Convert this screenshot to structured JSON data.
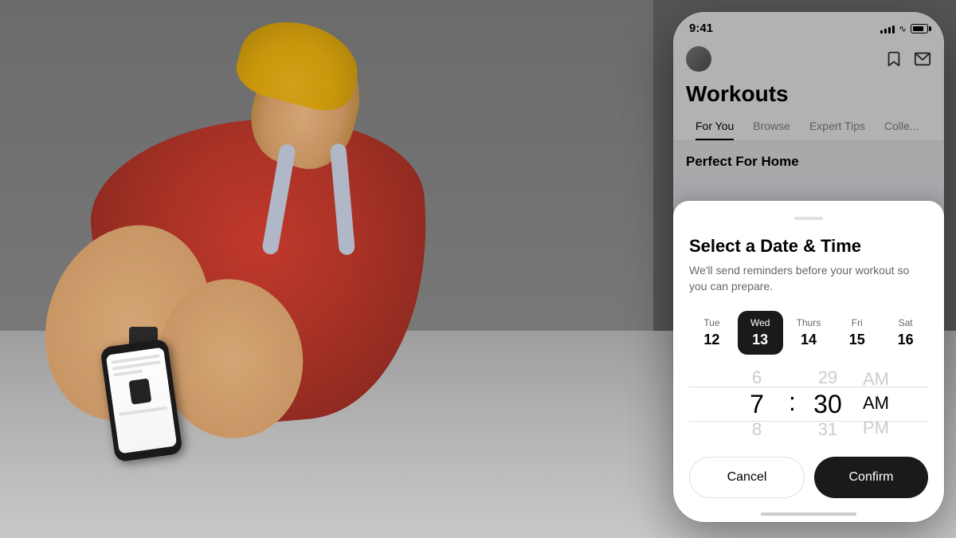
{
  "background": {
    "colors": {
      "wall": "#6b6b6b",
      "floor": "#b5b5b5"
    }
  },
  "phone_mockup": {
    "status_bar": {
      "time": "9:41",
      "signal": "signal",
      "wifi": "wifi",
      "battery": "battery"
    },
    "header": {
      "bookmark_icon": "bookmark",
      "mail_icon": "mail"
    },
    "title": "Workouts",
    "nav_tabs": [
      {
        "label": "For You",
        "active": true
      },
      {
        "label": "Browse",
        "active": false
      },
      {
        "label": "Expert Tips",
        "active": false
      },
      {
        "label": "Colle...",
        "active": false
      }
    ],
    "section_title": "Perfect For Home"
  },
  "modal": {
    "title": "Select a Date & Time",
    "subtitle": "We'll send reminders before your workout so you can prepare.",
    "days": [
      {
        "name": "Tue",
        "num": "12",
        "selected": false
      },
      {
        "name": "Wed",
        "num": "13",
        "selected": true
      },
      {
        "name": "Thurs",
        "num": "14",
        "selected": false
      },
      {
        "name": "Fri",
        "num": "15",
        "selected": false
      },
      {
        "name": "Sat",
        "num": "16",
        "selected": false
      }
    ],
    "time_picker": {
      "hour_above": "6",
      "hour_selected": "7",
      "hour_below": "8",
      "minute_above": "29",
      "minute_selected": "30",
      "minute_below": "31",
      "ampm_above": "AM",
      "ampm_selected": "AM",
      "ampm_below": "PM"
    },
    "cancel_label": "Cancel",
    "confirm_label": "Confirm"
  }
}
